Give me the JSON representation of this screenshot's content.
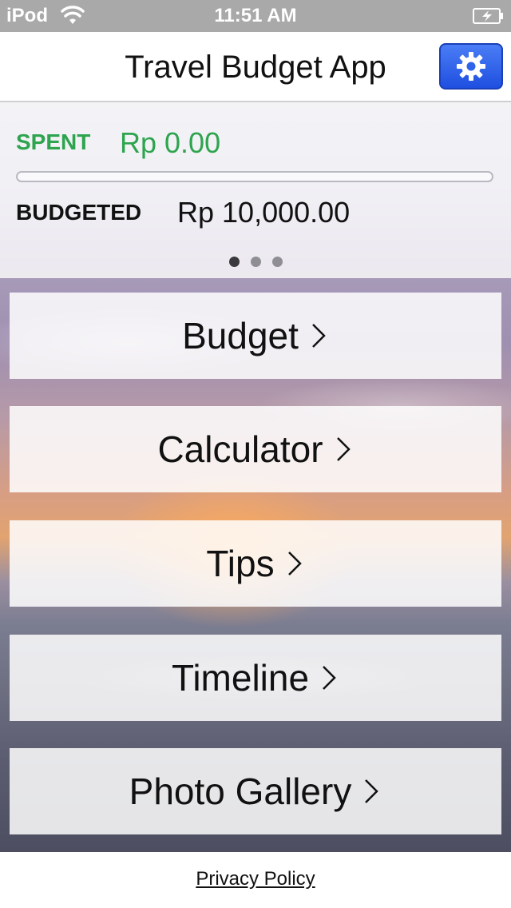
{
  "status_bar": {
    "device": "iPod",
    "time": "11:51 AM",
    "wifi_icon": "wifi-icon",
    "battery_icon": "battery-charging-icon"
  },
  "nav": {
    "title": "Travel Budget App",
    "settings_icon": "gear-icon",
    "accent_color": "#2f63ea"
  },
  "summary": {
    "spent_label": "SPENT",
    "spent_value": "Rp 0.00",
    "spent_color": "#2ea44f",
    "budgeted_label": "BUDGETED",
    "budgeted_value": "Rp 10,000.00",
    "progress_fraction": 0.0,
    "pages": 3,
    "current_page": 1
  },
  "menu": [
    {
      "label": "Budget"
    },
    {
      "label": "Calculator"
    },
    {
      "label": "Tips"
    },
    {
      "label": "Timeline"
    },
    {
      "label": "Photo Gallery"
    }
  ],
  "footer": {
    "privacy_label": "Privacy Policy"
  }
}
